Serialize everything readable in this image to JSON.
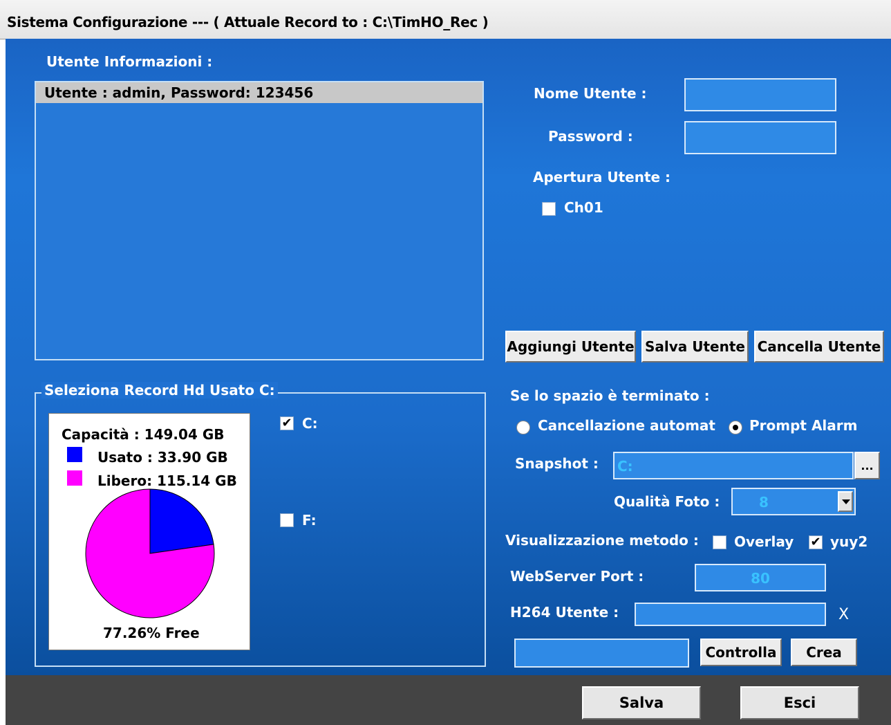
{
  "window": {
    "title": "Sistema Configurazione --- ( Attuale Record to : C:\\TimHO_Rec )"
  },
  "users": {
    "header": "Utente Informazioni :",
    "list": [
      "Utente : admin, Password: 123456"
    ],
    "name_label": "Nome Utente :",
    "password_label": "Password :",
    "opening_label": "Apertura Utente :",
    "channel_label": "Ch01",
    "buttons": {
      "add": "Aggiungi Utente",
      "save": "Salva Utente",
      "delete": "Cancella Utente"
    }
  },
  "hd": {
    "group_label": "Seleziona Record Hd Usato C:",
    "drives": [
      {
        "label": "C:",
        "checked": true
      },
      {
        "label": "F:",
        "checked": false
      }
    ],
    "capacity": "Capacità : 149.04 GB",
    "used": "Usato : 33.90 GB",
    "free": "Libero: 115.14 GB",
    "free_pct": "77.26% Free",
    "colors": {
      "used": "#0000ff",
      "free": "#ff00ff"
    }
  },
  "chart_data": {
    "type": "pie",
    "labels": [
      "Usato",
      "Libero"
    ],
    "values": [
      33.9,
      115.14
    ],
    "unit": "GB",
    "colors": [
      "#0000ff",
      "#ff00ff"
    ]
  },
  "settings": {
    "space_label": "Se lo spazio è terminato :",
    "radio_auto": "Cancellazione automat",
    "radio_prompt": "Prompt Alarm",
    "radio_selected": "prompt",
    "snapshot_label": "Snapshot :",
    "snapshot_value": "C:",
    "browse_label": "...",
    "quality_label": "Qualità Foto :",
    "quality_value": "8",
    "display_label": "Visualizzazione metodo :",
    "overlay_label": "Overlay",
    "overlay_checked": false,
    "yuy2_label": "yuy2",
    "yuy2_checked": true,
    "webport_label": "WebServer Port :",
    "webport_value": "80",
    "h264_label": "H264 Utente :",
    "h264_clear": "X",
    "check_button": "Controlla",
    "create_button": "Crea"
  },
  "footer": {
    "save": "Salva",
    "exit": "Esci"
  }
}
